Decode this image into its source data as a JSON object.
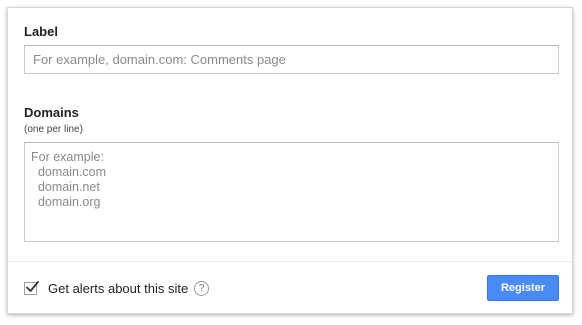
{
  "form": {
    "label_field": {
      "title": "Label",
      "value": "",
      "placeholder": "For example, domain.com: Comments page"
    },
    "domains_field": {
      "title": "Domains",
      "hint": "(one per line)",
      "value": "",
      "placeholder": "For example:\n  domain.com\n  domain.net\n  domain.org"
    },
    "alerts_checkbox": {
      "label": "Get alerts about this site",
      "checked": true,
      "help_icon": "question-mark-icon",
      "help_glyph": "?"
    },
    "register_button": {
      "label": "Register",
      "color": "#4a8af4"
    }
  }
}
